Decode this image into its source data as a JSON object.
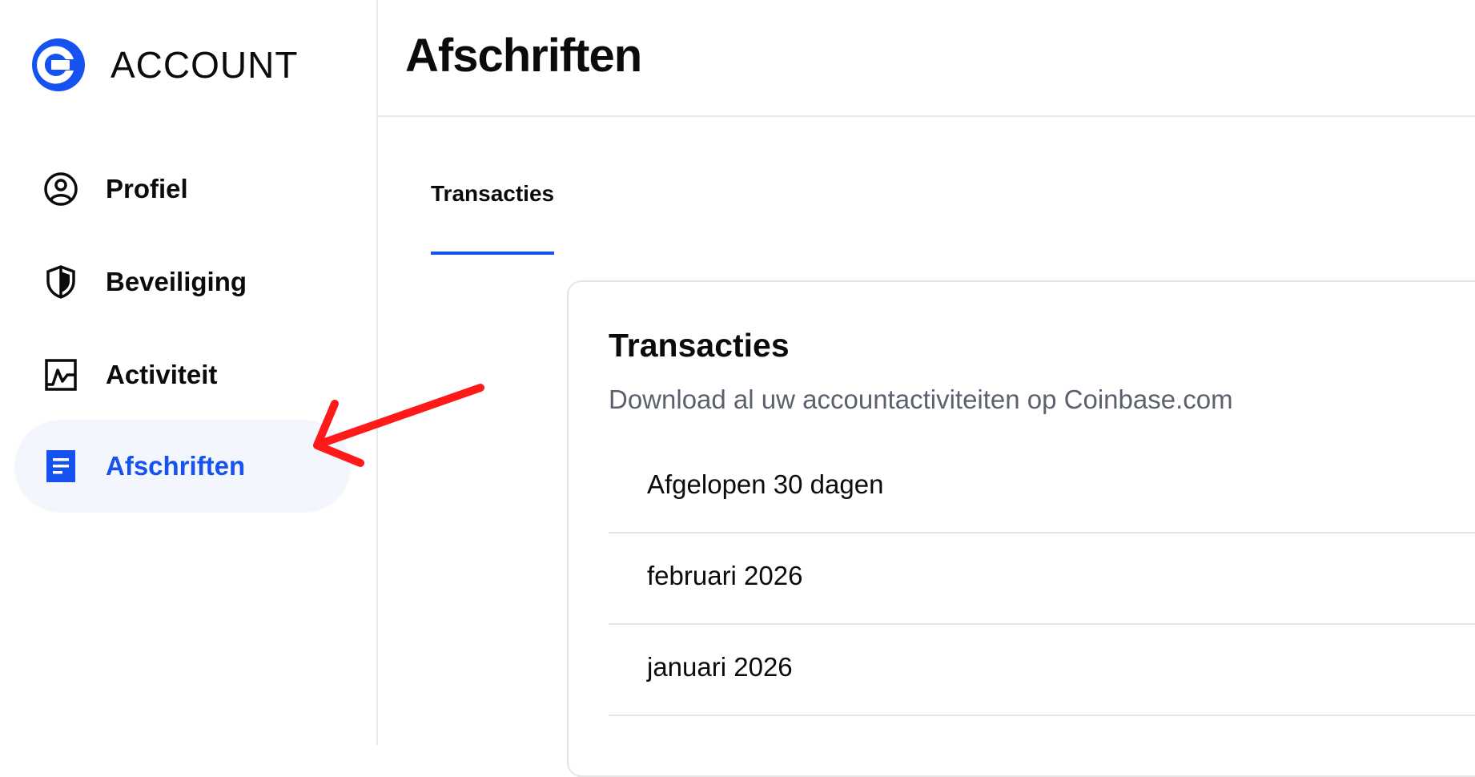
{
  "brand": {
    "name": "ACCOUNT",
    "logo_icon": "coinbase-logo-icon",
    "color": "#1652f0"
  },
  "sidebar": {
    "items": [
      {
        "label": "Profiel",
        "icon": "user-circle-icon",
        "active": false
      },
      {
        "label": "Beveiliging",
        "icon": "shield-icon",
        "active": false
      },
      {
        "label": "Activiteit",
        "icon": "activity-chart-icon",
        "active": false
      },
      {
        "label": "Afschriften",
        "icon": "document-icon",
        "active": true
      }
    ]
  },
  "header": {
    "title": "Afschriften"
  },
  "tabs": [
    {
      "label": "Transacties",
      "selected": true
    }
  ],
  "card": {
    "title": "Transacties",
    "subtitle": "Download al uw accountactiviteiten op Coinbase.com",
    "rows": [
      {
        "label": "Afgelopen 30 dagen"
      },
      {
        "label": "februari 2026"
      },
      {
        "label": "januari 2026"
      }
    ]
  },
  "colors": {
    "accent": "#1652f0",
    "active_bg": "#f3f6fd",
    "annotation": "#ff1a1a",
    "muted_text": "#5b616e"
  }
}
